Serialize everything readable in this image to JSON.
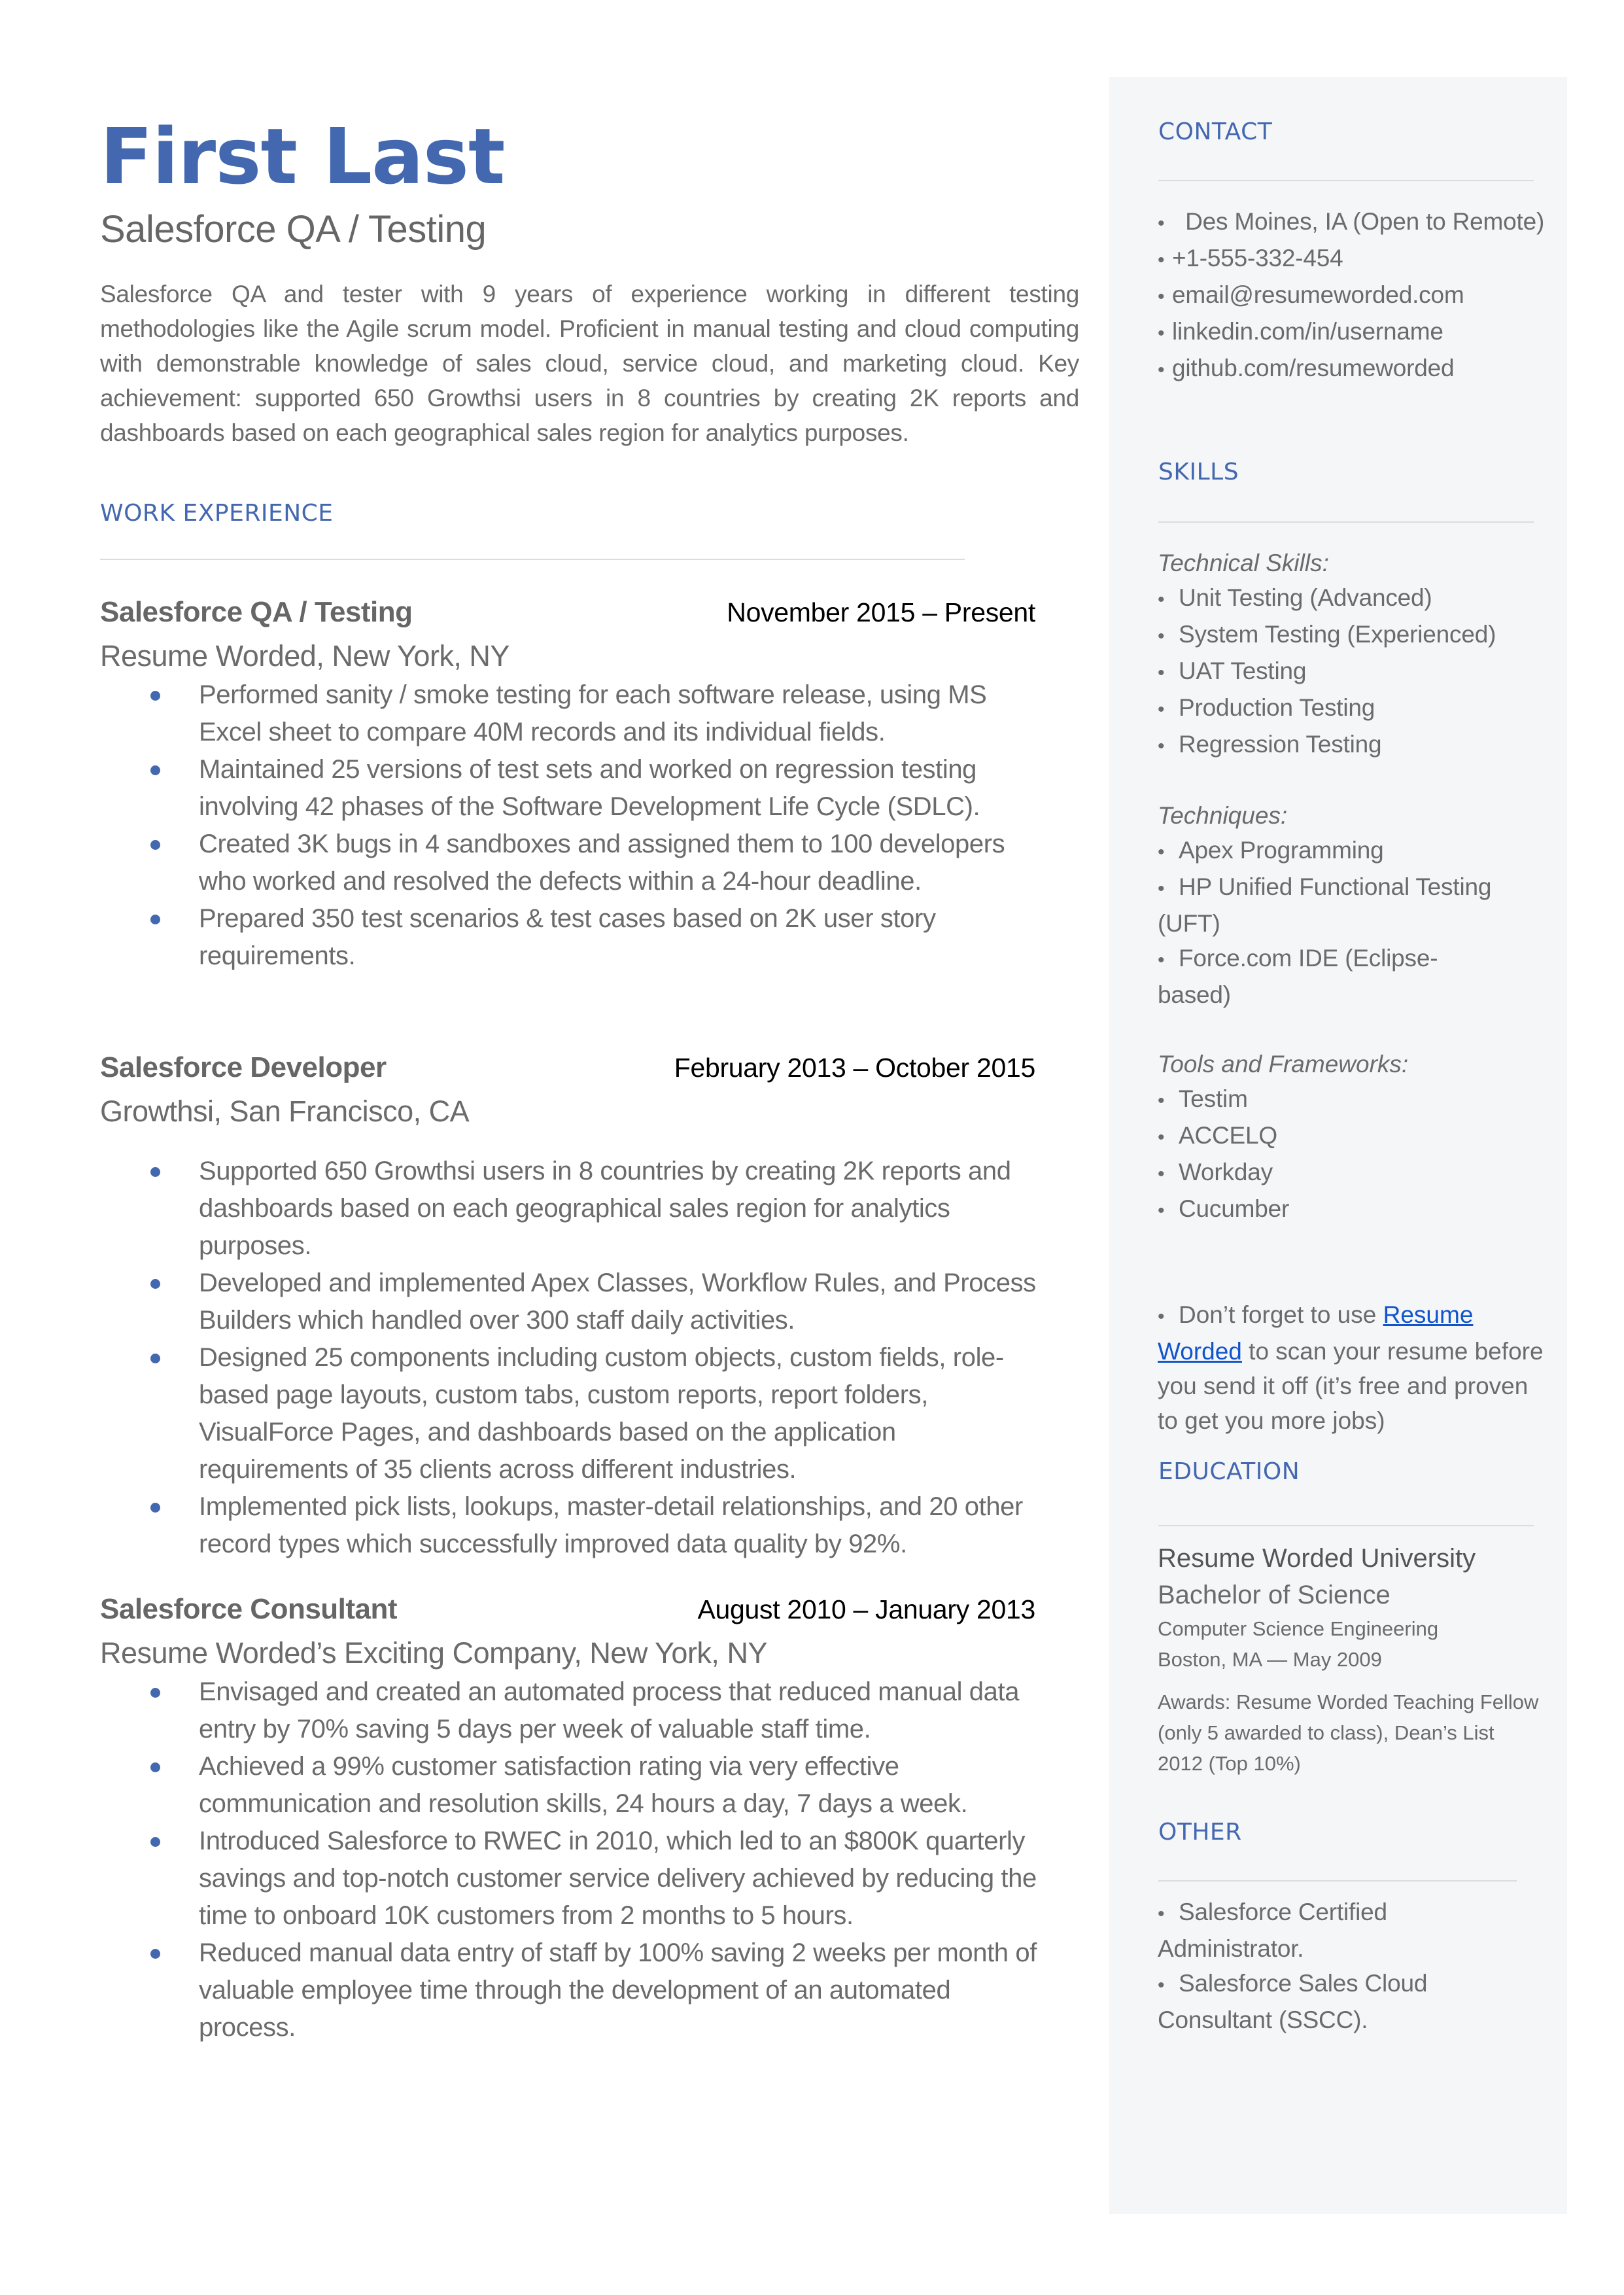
{
  "header": {
    "name": "First Last",
    "title": "Salesforce QA / Testing",
    "summary": "Salesforce QA and tester with 9 years of experience working in different testing methodologies like the Agile scrum model. Proficient in manual testing and cloud computing with demonstrable knowledge of sales cloud, service cloud, and marketing cloud. Key achievement: supported 650 Growthsi users in 8 countries by creating 2K reports and dashboards based on each geographical sales region for analytics purposes."
  },
  "colors": {
    "accent": "#4468b0",
    "sidebar_bg": "#f5f6f8",
    "link": "#1155cc",
    "text": "#666666"
  },
  "work": {
    "heading": "WORK EXPERIENCE",
    "jobs": [
      {
        "title": "Salesforce QA / Testing",
        "dates": "November 2015 – Present",
        "company": "Resume Worded, New York, NY",
        "bullets": [
          "Performed sanity / smoke testing for each software release, using MS Excel sheet to compare 40M records and its individual fields.",
          "Maintained 25 versions of test sets and worked on regression testing involving 42 phases of the Software Development Life Cycle (SDLC).",
          "Created 3K bugs in 4 sandboxes and assigned them to 100 developers who worked and resolved the defects within a 24-hour deadline.",
          "Prepared 350 test scenarios & test cases based on 2K user story requirements."
        ]
      },
      {
        "title": "Salesforce Developer",
        "dates": "February 2013 – October 2015",
        "company": "Growthsi, San Francisco, CA",
        "bullets": [
          "Supported 650 Growthsi users in 8 countries by creating 2K reports and dashboards based on each geographical sales region for analytics purposes.",
          "Developed and implemented Apex Classes, Workflow Rules, and Process Builders which handled over 300 staff daily activities.",
          "Designed 25 components including custom objects, custom fields, role-based page layouts, custom tabs, custom reports, report folders, VisualForce Pages, and dashboards based on the application requirements of 35 clients across different industries.",
          "Implemented pick lists, lookups, master-detail relationships, and 20 other record types which successfully improved data quality by 92%."
        ]
      },
      {
        "title": "Salesforce Consultant",
        "dates": "August 2010 – January 2013",
        "company": "Resume Worded’s Exciting Company, New York, NY",
        "bullets": [
          "Envisaged and created an automated process that reduced manual data entry by 70% saving 5 days per week of valuable staff time.",
          "Achieved a 99% customer satisfaction rating via very effective communication and resolution skills, 24 hours a day, 7 days a week.",
          "Introduced Salesforce to RWEC in 2010, which led to an $800K quarterly savings and top-notch customer service delivery achieved by reducing the time to onboard 10K customers from 2 months to 5 hours.",
          "Reduced manual data entry of staff by 100% saving 2 weeks per month of valuable employee time through the development of an automated process."
        ]
      }
    ]
  },
  "contact": {
    "heading": "CONTACT",
    "items": [
      " Des Moines, IA (Open to Remote)",
      "+1-555-332-454",
      "email@resumeworded.com",
      "linkedin.com/in/username",
      "github.com/resumeworded"
    ]
  },
  "skills": {
    "heading": "SKILLS",
    "groups": [
      {
        "label": "Technical Skills:",
        "items": [
          "Unit Testing (Advanced)",
          "System Testing (Experienced)",
          "UAT Testing",
          "Production Testing",
          "Regression Testing"
        ]
      },
      {
        "label": "Techniques:",
        "items": [
          "Apex Programming",
          "HP Unified Functional Testing (UFT)",
          "Force.com IDE (Eclipse-based)"
        ]
      },
      {
        "label": "Tools and Frameworks:",
        "items": [
          "Testim",
          "ACCELQ",
          "Workday",
          "Cucumber"
        ]
      }
    ],
    "tip": {
      "prefix": "Don’t forget to use ",
      "link": "Resume Worded",
      "suffix": " to scan your resume before you send it off (it’s free and proven to get you more jobs)"
    }
  },
  "education": {
    "heading": "EDUCATION",
    "school": "Resume Worded University",
    "degree": "Bachelor of Science",
    "field": "Computer Science Engineering",
    "location_date": "Boston, MA — May 2009",
    "awards": "Awards: Resume Worded Teaching Fellow (only 5 awarded to class), Dean’s List 2012 (Top 10%)"
  },
  "other": {
    "heading": "OTHER",
    "items": [
      "Salesforce Certified Administrator.",
      "Salesforce Sales Cloud Consultant (SSCC)."
    ]
  }
}
